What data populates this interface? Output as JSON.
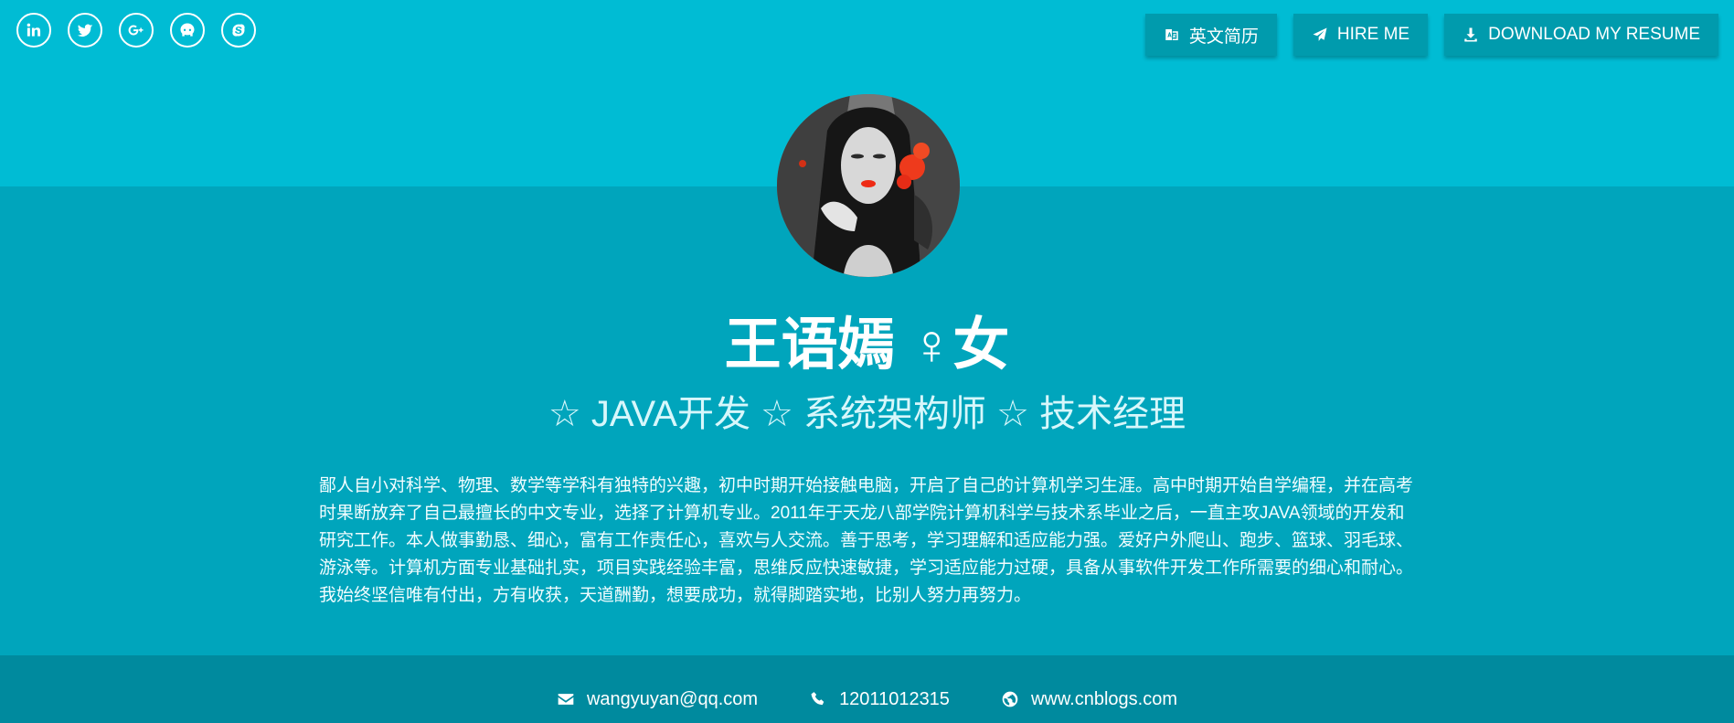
{
  "social": {
    "items": [
      {
        "name": "linkedin-icon"
      },
      {
        "name": "twitter-icon"
      },
      {
        "name": "google-plus-icon"
      },
      {
        "name": "github-icon"
      },
      {
        "name": "skype-icon"
      }
    ]
  },
  "actions": {
    "english_resume": "英文简历",
    "hire_me": "HIRE ME",
    "download_resume": "DOWNLOAD MY RESUME"
  },
  "profile": {
    "name": "王语嫣 ♀女",
    "subtitle": "☆ JAVA开发 ☆ 系统架构师 ☆ 技术经理",
    "bio": "鄙人自小对科学、物理、数学等学科有独特的兴趣，初中时期开始接触电脑，开启了自己的计算机学习生涯。高中时期开始自学编程，并在高考时果断放弃了自己最擅长的中文专业，选择了计算机专业。2011年于天龙八部学院计算机科学与技术系毕业之后，一直主攻JAVA领域的开发和研究工作。本人做事勤恳、细心，富有工作责任心，喜欢与人交流。善于思考，学习理解和适应能力强。爱好户外爬山、跑步、篮球、羽毛球、游泳等。计算机方面专业基础扎实，项目实践经验丰富，思维反应快速敏捷，学习适应能力过硬，具备从事软件开发工作所需要的细心和耐心。我始终坚信唯有付出，方有收获，天道酬勤，想要成功，就得脚踏实地，比别人努力再努力。"
  },
  "contact": {
    "email": "wangyuyan@qq.com",
    "phone": "12011012315",
    "website": "www.cnblogs.com"
  },
  "colors": {
    "top_band": "#00bcd4",
    "mid_band": "#00a5bc",
    "bottom_band": "#008a9e"
  }
}
